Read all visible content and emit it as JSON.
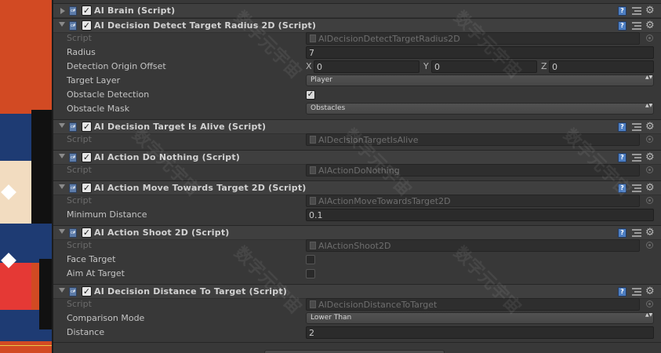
{
  "components": [
    {
      "title": "AI Brain (Script)",
      "expanded": false,
      "fields": []
    },
    {
      "title": "AI Decision Detect Target Radius 2D (Script)",
      "expanded": true,
      "script": "AIDecisionDetectTargetRadius2D",
      "fields": [
        {
          "label": "Radius",
          "type": "text",
          "value": "7"
        },
        {
          "label": "Detection Origin Offset",
          "type": "vector3",
          "x": "0",
          "y": "0",
          "z": "0"
        },
        {
          "label": "Target Layer",
          "type": "dropdown",
          "value": "Player"
        },
        {
          "label": "Obstacle Detection",
          "type": "checkbox",
          "checked": true
        },
        {
          "label": "Obstacle Mask",
          "type": "dropdown",
          "value": "Obstacles"
        }
      ]
    },
    {
      "title": "AI Decision Target Is Alive (Script)",
      "expanded": true,
      "script": "AIDecisionTargetIsAlive",
      "fields": []
    },
    {
      "title": "AI Action Do Nothing (Script)",
      "expanded": true,
      "script": "AIActionDoNothing",
      "fields": []
    },
    {
      "title": "AI Action Move Towards Target 2D (Script)",
      "expanded": true,
      "script": "AIActionMoveTowardsTarget2D",
      "fields": [
        {
          "label": "Minimum Distance",
          "type": "text",
          "value": "0.1"
        }
      ]
    },
    {
      "title": "AI Action Shoot 2D (Script)",
      "expanded": true,
      "script": "AIActionShoot2D",
      "fields": [
        {
          "label": "Face Target",
          "type": "checkbox",
          "checked": false
        },
        {
          "label": "Aim At Target",
          "type": "checkbox",
          "checked": false
        }
      ]
    },
    {
      "title": "AI Decision Distance To Target (Script)",
      "expanded": true,
      "script": "AIDecisionDistanceToTarget",
      "fields": [
        {
          "label": "Comparison Mode",
          "type": "dropdown",
          "value": "Lower Than"
        },
        {
          "label": "Distance",
          "type": "text",
          "value": "2"
        }
      ]
    }
  ],
  "labels": {
    "script": "Script",
    "vector_x": "X",
    "vector_y": "Y",
    "vector_z": "Z",
    "script_badge": "c#",
    "help_badge": "?",
    "check_mark": "✓",
    "gear_glyph": "⚙",
    "arrows_glyph": "▲▼"
  },
  "watermark": "数字元宇宙",
  "icons": [
    "foldout-arrow-icon",
    "script-file-icon",
    "enable-checkbox",
    "help-icon",
    "preset-icon",
    "gear-icon",
    "object-picker-icon"
  ],
  "colors": {
    "inspector_bg": "#383838",
    "header_bg": "#3f3f3f",
    "scene_bg": "#d24a23",
    "help_blue": "#4d7ec2"
  }
}
